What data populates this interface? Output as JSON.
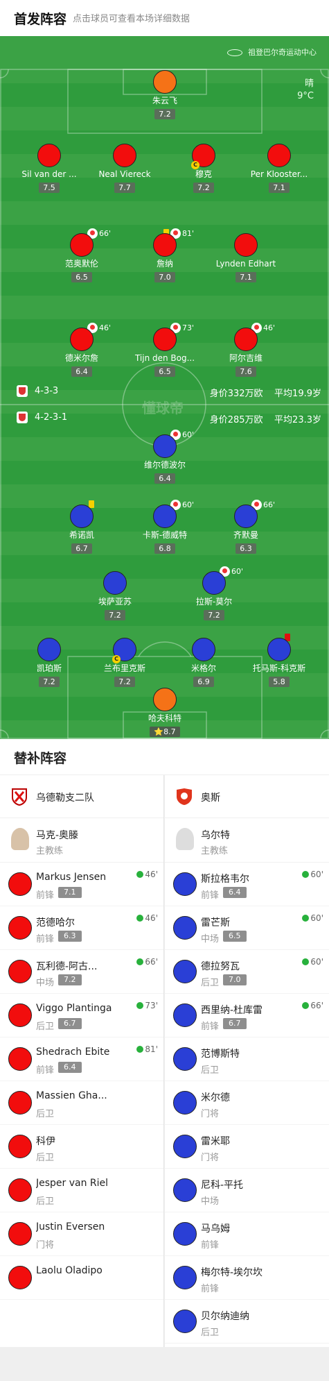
{
  "header": {
    "title": "首发阵容",
    "subtitle": "点击球员可查看本场详细数据"
  },
  "pitch": {
    "venue": "祖登巴尔奇运动中心",
    "weather": "晴",
    "temperature": "9°C",
    "watermark": "懂球帝",
    "home": {
      "formation": "4-3-3",
      "value": "身价332万欧",
      "age": "平均19.9岁"
    },
    "away": {
      "formation": "4-2-3-1",
      "value": "身价285万欧",
      "age": "平均23.3岁"
    }
  },
  "players": [
    {
      "name": "朱云飞",
      "rating": "7.2",
      "color": "orange"
    },
    {
      "name": "Sil van der ...",
      "rating": "7.5",
      "color": "red"
    },
    {
      "name": "Neal Viereck",
      "rating": "7.7",
      "color": "red"
    },
    {
      "name": "穆克",
      "rating": "7.2",
      "color": "red"
    },
    {
      "name": "Per Klooster...",
      "rating": "7.1",
      "color": "red"
    },
    {
      "name": "范奥默伦",
      "rating": "6.5",
      "color": "red",
      "sub": "66'"
    },
    {
      "name": "詹纳",
      "rating": "7.0",
      "color": "red",
      "sub": "81'"
    },
    {
      "name": "Lynden Edhart",
      "rating": "7.1",
      "color": "red"
    },
    {
      "name": "德米尔詹",
      "rating": "6.4",
      "color": "red",
      "sub": "46'"
    },
    {
      "name": "Tijn den Bog...",
      "rating": "6.5",
      "color": "red",
      "sub": "73'"
    },
    {
      "name": "阿尔吉维",
      "rating": "7.6",
      "color": "red",
      "sub": "46'"
    },
    {
      "name": "维尔德波尔",
      "rating": "6.4",
      "color": "blue",
      "sub": "60'"
    },
    {
      "name": "希诺凯",
      "rating": "6.7",
      "color": "blue"
    },
    {
      "name": "卡斯-德威特",
      "rating": "6.8",
      "color": "blue",
      "sub": "60'"
    },
    {
      "name": "齐默曼",
      "rating": "6.3",
      "color": "blue",
      "sub": "66'"
    },
    {
      "name": "埃萨亚苏",
      "rating": "7.2",
      "color": "blue"
    },
    {
      "name": "拉斯-莫尔",
      "rating": "7.2",
      "color": "blue",
      "sub": "60'"
    },
    {
      "name": "凯珀斯",
      "rating": "7.2",
      "color": "blue"
    },
    {
      "name": "兰布里克斯",
      "rating": "7.2",
      "color": "blue"
    },
    {
      "name": "米格尔",
      "rating": "6.9",
      "color": "blue"
    },
    {
      "name": "托马斯-科克斯",
      "rating": "5.8",
      "color": "blue"
    },
    {
      "name": "哈夫科特",
      "rating": "8.7",
      "color": "orange",
      "star": "⭐"
    }
  ],
  "bench": {
    "title": "替补阵容",
    "home": {
      "team": "乌德勒支二队",
      "coach": "马克-奥滕",
      "coach_role": "主教练",
      "players": [
        {
          "name": "Markus Jensen",
          "pos": "前锋",
          "rating": "7.1",
          "in": "46'"
        },
        {
          "name": "范德哈尔",
          "pos": "前锋",
          "rating": "6.3",
          "in": "46'"
        },
        {
          "name": "瓦利德-阿古...",
          "pos": "中场",
          "rating": "7.2",
          "in": "66'"
        },
        {
          "name": "Viggo Plantinga",
          "pos": "后卫",
          "rating": "6.7",
          "in": "73'"
        },
        {
          "name": "Shedrach Ebite",
          "pos": "前锋",
          "rating": "6.4",
          "in": "81'"
        },
        {
          "name": "Massien Gha...",
          "pos": "后卫"
        },
        {
          "name": "科伊",
          "pos": "后卫"
        },
        {
          "name": "Jesper van Riel",
          "pos": "后卫"
        },
        {
          "name": "Justin Eversen",
          "pos": "门将"
        },
        {
          "name": "Laolu Oladipo",
          "pos": ""
        }
      ]
    },
    "away": {
      "team": "奥斯",
      "coach": "乌尔特",
      "coach_role": "主教练",
      "players": [
        {
          "name": "斯拉格韦尔",
          "pos": "前锋",
          "rating": "6.4",
          "in": "60'"
        },
        {
          "name": "雷芒斯",
          "pos": "中场",
          "rating": "6.5",
          "in": "60'"
        },
        {
          "name": "德拉努瓦",
          "pos": "后卫",
          "rating": "7.0",
          "in": "60'"
        },
        {
          "name": "西里纳-杜库雷",
          "pos": "前锋",
          "rating": "6.7",
          "in": "66'"
        },
        {
          "name": "范博斯特",
          "pos": "后卫"
        },
        {
          "name": "米尔德",
          "pos": "门将"
        },
        {
          "name": "雷米耶",
          "pos": "门将"
        },
        {
          "name": "尼科-平托",
          "pos": "中场"
        },
        {
          "name": "马乌姆",
          "pos": "前锋"
        },
        {
          "name": "梅尔特-埃尔坎",
          "pos": "前锋"
        },
        {
          "name": "贝尔纳迪纳",
          "pos": "后卫"
        }
      ]
    }
  },
  "colors": {
    "pitch": "#3ba245",
    "home": "#f20d0d",
    "away": "#2a3fd6",
    "keeper": "#f57217"
  }
}
